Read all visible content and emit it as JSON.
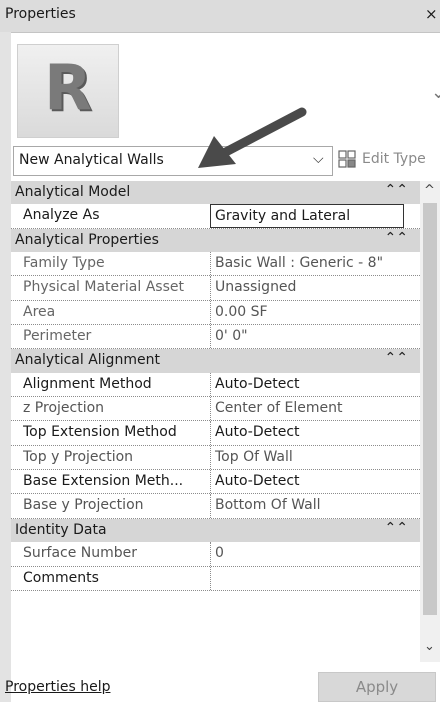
{
  "window": {
    "title": "Properties",
    "close_glyph": "×"
  },
  "logo": {
    "letter": "R"
  },
  "type_selector": {
    "value": "New Analytical Walls",
    "chevron": "⌵",
    "edit_type_label": "Edit Type"
  },
  "groups": [
    {
      "label": "Analytical Model",
      "collapse": "⌃⌃",
      "rows": [
        {
          "name": "Analyze As",
          "value": "Gravity and Lateral"
        }
      ]
    },
    {
      "label": "Analytical Properties",
      "collapse": "⌃⌃",
      "rows": [
        {
          "name": "Family Type",
          "value": "Basic Wall : Generic - 8\""
        },
        {
          "name": "Physical Material Asset",
          "value": "Unassigned"
        },
        {
          "name": "Area",
          "value": "0.00 SF"
        },
        {
          "name": "Perimeter",
          "value": "0'  0\""
        }
      ]
    },
    {
      "label": "Analytical Alignment",
      "collapse": "⌃⌃",
      "rows": [
        {
          "name": "Alignment Method",
          "value": "Auto-Detect"
        },
        {
          "name": "z Projection",
          "value": "Center of Element"
        },
        {
          "name": "Top Extension Method",
          "value": "Auto-Detect"
        },
        {
          "name": "Top y Projection",
          "value": "Top Of Wall"
        },
        {
          "name": "Base Extension Meth...",
          "value": "Auto-Detect"
        },
        {
          "name": "Base y Projection",
          "value": "Bottom Of Wall"
        }
      ]
    },
    {
      "label": "Identity Data",
      "collapse": "⌃⌃",
      "rows": [
        {
          "name": "Surface Number",
          "value": "0"
        },
        {
          "name": "Comments",
          "value": ""
        }
      ]
    }
  ],
  "scrollbar": {
    "up": "^",
    "down": "⌄"
  },
  "footer": {
    "help_link": "Properties help",
    "apply_label": "Apply"
  },
  "colors": {
    "group_bg": "#d6d6d6",
    "title_bg": "#dcdcdc",
    "arrow": "#4a4a4a"
  }
}
